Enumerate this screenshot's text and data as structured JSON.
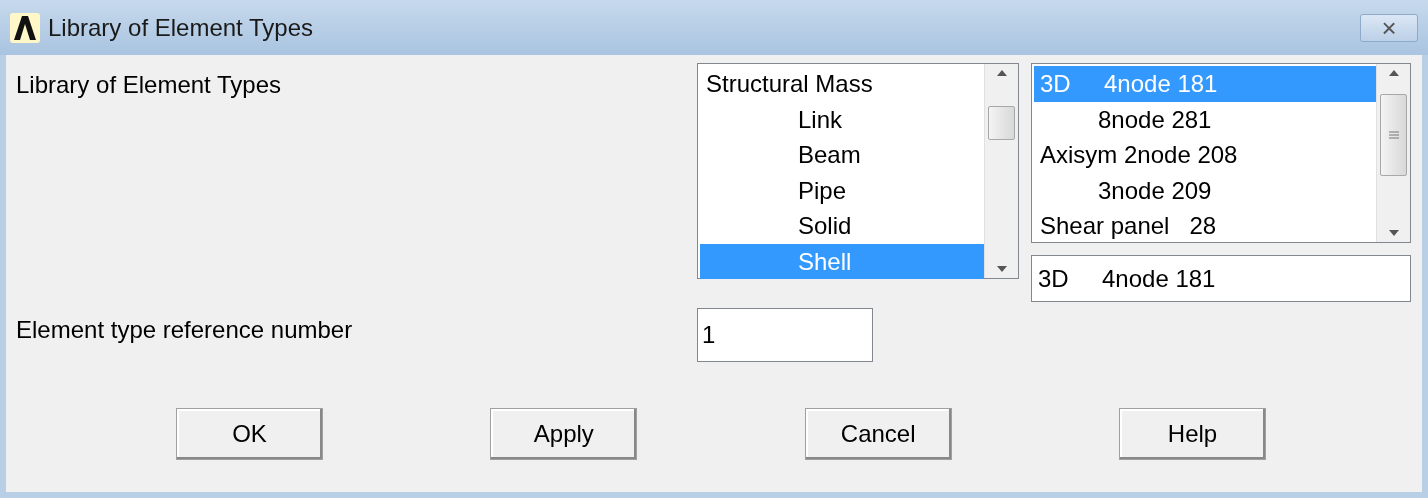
{
  "window": {
    "title": "Library of Element Types",
    "close": "×"
  },
  "heading": "Library of Element Types",
  "category_list": {
    "items": [
      {
        "label": "Structural Mass",
        "kind": "group",
        "selected": false
      },
      {
        "label": "Link",
        "kind": "sub",
        "selected": false
      },
      {
        "label": "Beam",
        "kind": "sub",
        "selected": false
      },
      {
        "label": "Pipe",
        "kind": "sub",
        "selected": false
      },
      {
        "label": "Solid",
        "kind": "sub",
        "selected": false
      },
      {
        "label": "Shell",
        "kind": "sub",
        "selected": true
      }
    ]
  },
  "element_list": {
    "items": [
      {
        "label": "3D     4node 181",
        "kind": "group",
        "selected": true
      },
      {
        "label": "8node 281",
        "kind": "sub",
        "selected": false
      },
      {
        "label": "Axisym 2node 208",
        "kind": "group",
        "selected": false
      },
      {
        "label": "3node 209",
        "kind": "sub",
        "selected": false
      },
      {
        "label": "Shear panel   28",
        "kind": "group",
        "selected": false
      }
    ]
  },
  "selection_field": {
    "value": "3D     4node 181"
  },
  "reference_number": {
    "label": "Element type reference number",
    "value": "1"
  },
  "buttons": [
    "OK",
    "Apply",
    "Cancel",
    "Help"
  ]
}
